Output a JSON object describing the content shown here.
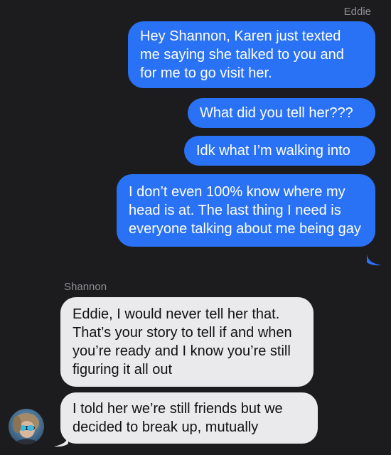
{
  "conversation": {
    "outgoing_sender": "Eddie",
    "incoming_sender": "Shannon",
    "outgoing_messages": [
      "Hey Shannon, Karen just texted me saying she talked to you and for me to go visit her.",
      "What did you tell her???",
      "Idk what I’m walking into",
      "I don’t even 100% know where my head is at. The last thing I need is everyone talking about me being gay"
    ],
    "incoming_messages": [
      "Eddie, I would never tell her that. That’s your story to tell if and when you’re ready and I know you’re still figuring it all out",
      "I told her we’re still friends but we decided to break up, mutually"
    ]
  },
  "colors": {
    "background": "#1c1c1e",
    "outgoing_bubble": "#2a72f5",
    "incoming_bubble": "#eaeaec",
    "sender_label": "#8e8e93"
  },
  "icons": {
    "avatar": "contact-avatar-icon"
  }
}
